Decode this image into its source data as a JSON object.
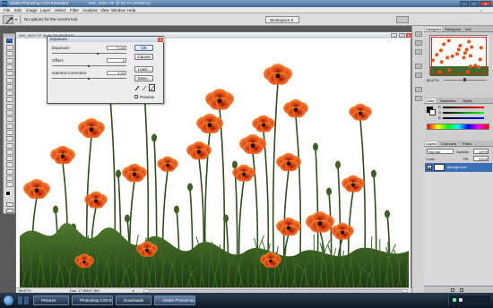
{
  "window": {
    "app_title": "Adobe Photoshop CS3 Extended",
    "doc_title_extra": "- IMG_0000.TIF @ 66.7% (RGB/16)",
    "doc_tab_title": "IMG_0000.TIF @ 66.7% (RGB/16)"
  },
  "menu": [
    "File",
    "Edit",
    "Image",
    "Layer",
    "Select",
    "Filter",
    "Analysis",
    "View",
    "Window",
    "Help"
  ],
  "options_bar": {
    "hint": "No options for the current tool.",
    "workspace": "Workspace"
  },
  "document": {
    "zoom": "66.67%",
    "doc_info": "Doc: 17.8M/17.8M"
  },
  "exposure_dialog": {
    "title": "Exposure",
    "exposure_label": "Exposure:",
    "exposure_value": "+1.65",
    "exposure_level": 0.62,
    "offset_label": "Offset:",
    "offset_value": "0",
    "offset_level": 0.5,
    "gamma_label": "Gamma Correction:",
    "gamma_value": "1.00",
    "gamma_level": 0.5,
    "ok": "OK",
    "cancel": "Cancel",
    "load": "Load...",
    "save": "Save...",
    "preview": "Preview",
    "preview_checked": true
  },
  "panels": {
    "navigator_tabs": [
      "Navigator",
      "Histogram",
      "Info"
    ],
    "navigator_zoom": "66.67%",
    "color_tabs": [
      "Color",
      "Swatches",
      "Styles"
    ],
    "color_sliders": [
      "R",
      "G",
      "B"
    ],
    "layers_tabs": [
      "Layers",
      "Channels",
      "Paths"
    ],
    "blend_mode": "Normal",
    "opacity_label": "Opacity:",
    "opacity_value": "100%",
    "lock_label": "Lock:",
    "fill_label": "Fill:",
    "fill_value": "100%",
    "layer_name": "Background"
  },
  "taskbar": {
    "items": [
      "Pictures",
      "Photoshop CS3 Ext",
      "Downloads",
      "Adobe Photoshop C..."
    ]
  },
  "colors": {
    "titlebar": "#3f6793",
    "selected_layer": "#3b6fb8",
    "poppy": "#e8521a",
    "taskbar": "#1b2738"
  }
}
